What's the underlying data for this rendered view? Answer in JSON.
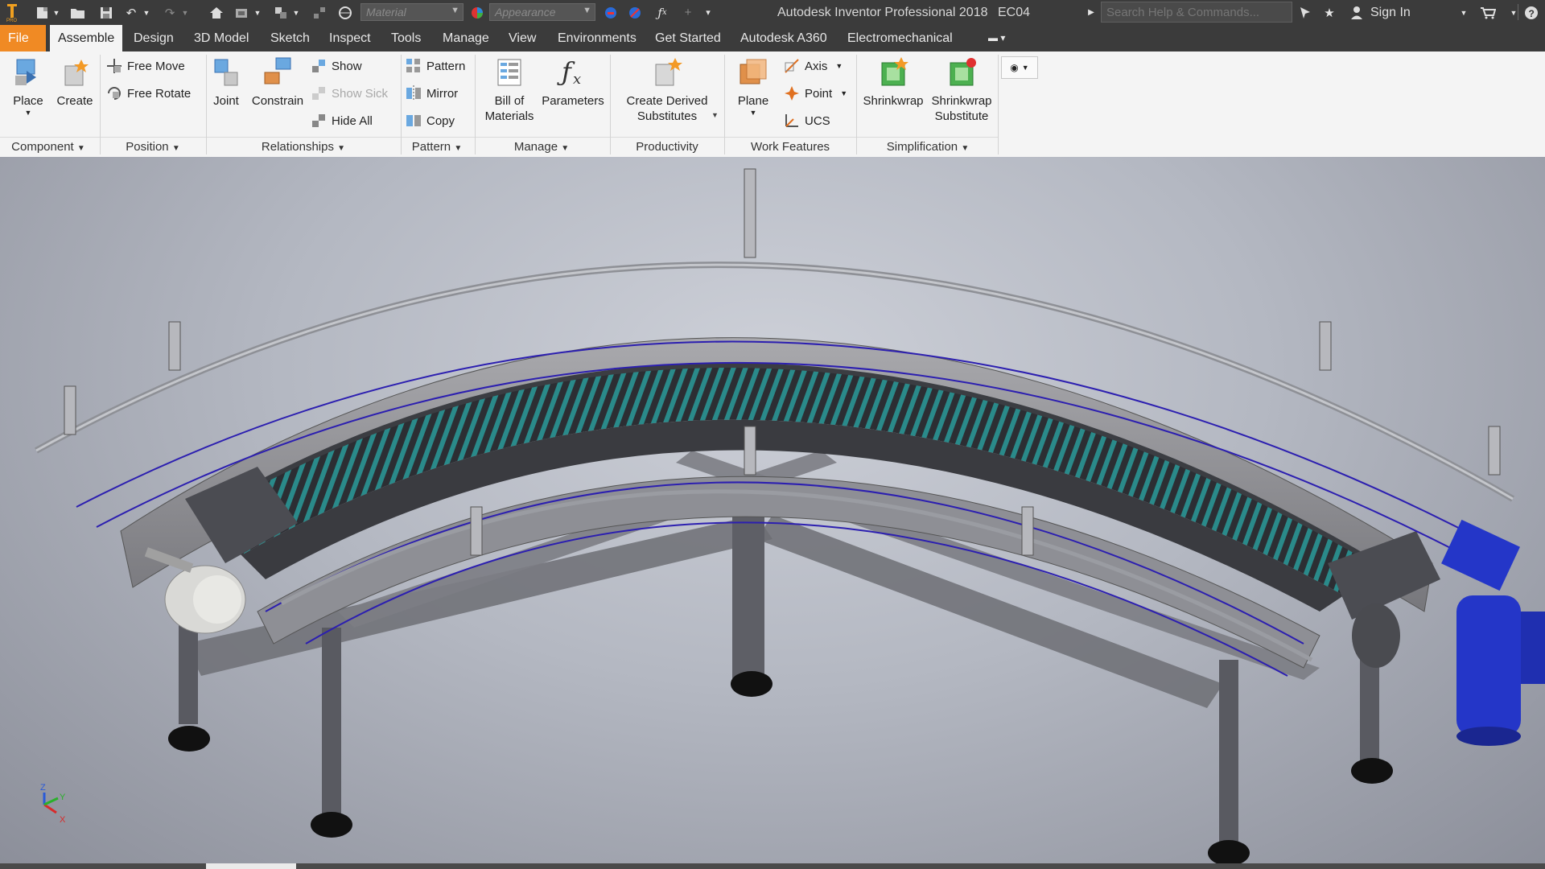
{
  "app": {
    "title": "Autodesk Inventor Professional 2018",
    "document": "EC04",
    "search_placeholder": "Search Help & Commands...",
    "sign_in": "Sign In",
    "material_placeholder": "Material",
    "appearance_placeholder": "Appearance"
  },
  "tabs": [
    "File",
    "Assemble",
    "Design",
    "3D Model",
    "Sketch",
    "Inspect",
    "Tools",
    "Manage",
    "View",
    "Environments",
    "Get Started",
    "Autodesk A360",
    "Electromechanical"
  ],
  "ribbon": {
    "component": {
      "title": "Component",
      "place": "Place",
      "create": "Create"
    },
    "position": {
      "title": "Position",
      "free_move": "Free Move",
      "free_rotate": "Free Rotate"
    },
    "relationships": {
      "title": "Relationships",
      "joint": "Joint",
      "constrain": "Constrain",
      "show": "Show",
      "show_sick": "Show Sick",
      "hide_all": "Hide All"
    },
    "pattern": {
      "title": "Pattern",
      "pattern": "Pattern",
      "mirror": "Mirror",
      "copy": "Copy"
    },
    "manage": {
      "title": "Manage",
      "bom": "Bill of\nMaterials",
      "bom_l1": "Bill of",
      "bom_l2": "Materials",
      "parameters": "Parameters"
    },
    "productivity": {
      "title": "Productivity",
      "cds_l1": "Create Derived",
      "cds_l2": "Substitutes"
    },
    "work_features": {
      "title": "Work Features",
      "plane": "Plane",
      "axis": "Axis",
      "point": "Point",
      "ucs": "UCS"
    },
    "simplification": {
      "title": "Simplification",
      "shrinkwrap": "Shrinkwrap",
      "sws_l1": "Shrinkwrap",
      "sws_l2": "Substitute"
    }
  },
  "viewport": {
    "model": "curved-chain-conveyor",
    "axis_labels": [
      "Z",
      "Y",
      "X"
    ]
  },
  "colors": {
    "title_bar": "#3b3b3b",
    "file_tab": "#f08a24",
    "ribbon": "#f4f4f4",
    "belt": "#2a8a8a",
    "motor": "#2436c8",
    "guide_line": "#2c1fb0"
  }
}
